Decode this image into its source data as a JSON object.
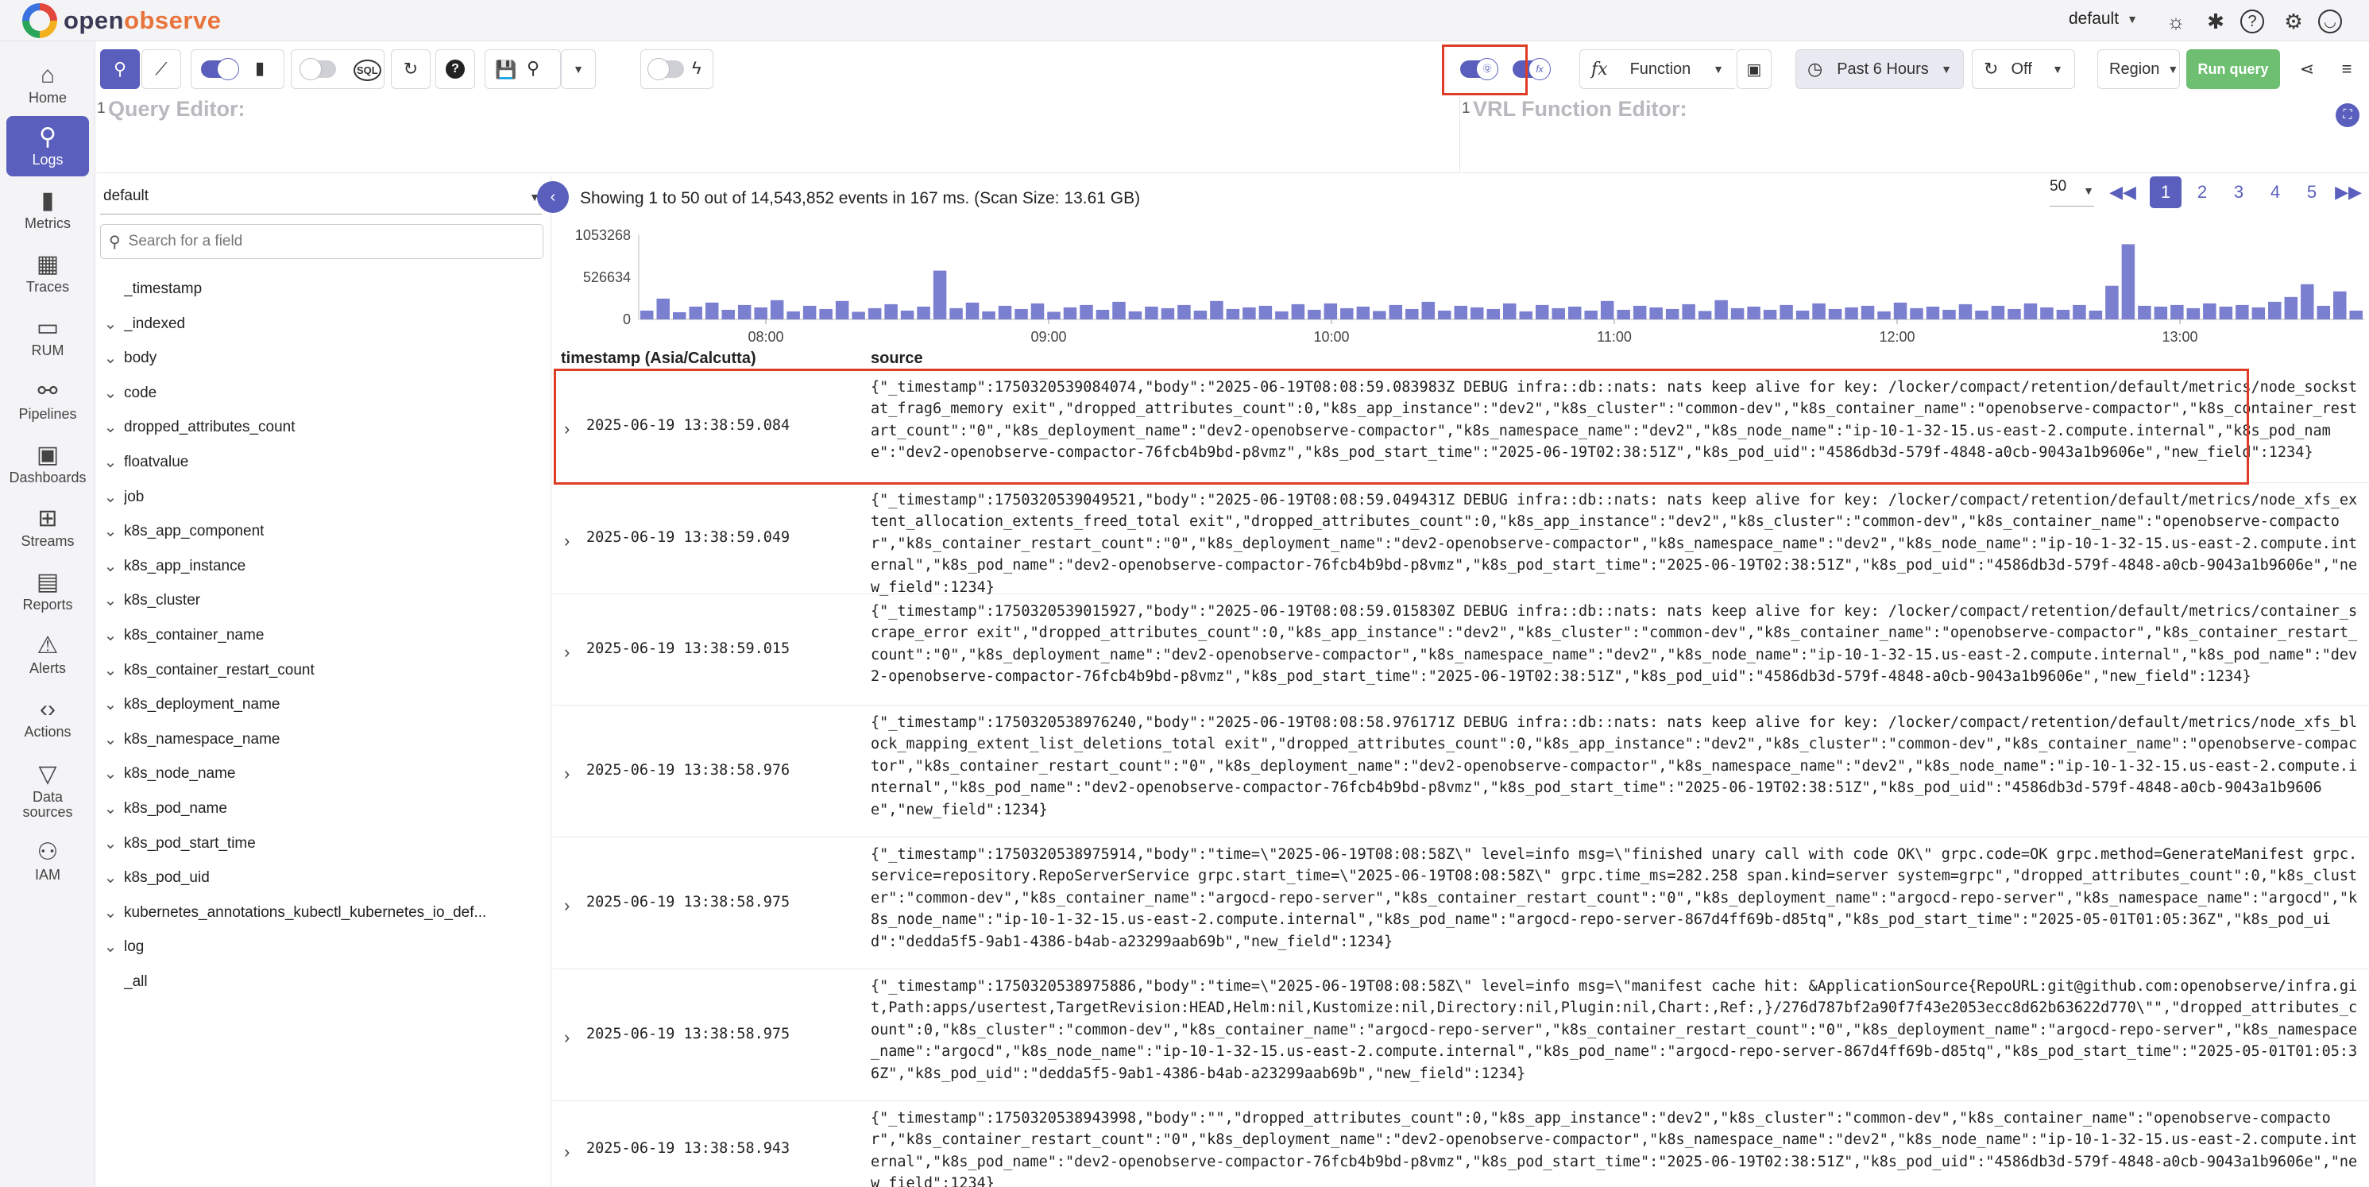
{
  "app": {
    "logo_part1": "open",
    "logo_part2": "observe",
    "org": "default"
  },
  "sidebar": {
    "items": [
      {
        "label": "Home",
        "icon": "home-icon",
        "glyph": "⌂"
      },
      {
        "label": "Logs",
        "icon": "search-icon",
        "glyph": "🔍"
      },
      {
        "label": "Metrics",
        "icon": "bar-chart-icon",
        "glyph": "▮"
      },
      {
        "label": "Traces",
        "icon": "traces-icon",
        "glyph": "▦"
      },
      {
        "label": "RUM",
        "icon": "devices-icon",
        "glyph": "▭"
      },
      {
        "label": "Pipelines",
        "icon": "pipelines-icon",
        "glyph": "⚯"
      },
      {
        "label": "Dashboards",
        "icon": "dashboard-icon",
        "glyph": "▣"
      },
      {
        "label": "Streams",
        "icon": "streams-icon",
        "glyph": "⊞"
      },
      {
        "label": "Reports",
        "icon": "reports-icon",
        "glyph": "▤"
      },
      {
        "label": "Alerts",
        "icon": "alert-icon",
        "glyph": "⚠"
      },
      {
        "label": "Actions",
        "icon": "code-icon",
        "glyph": "‹›"
      },
      {
        "label": "Data sources",
        "icon": "filter-icon",
        "glyph": "▽"
      },
      {
        "label": "IAM",
        "icon": "users-gear-icon",
        "glyph": "⚇"
      }
    ]
  },
  "toolbar": {
    "function_label": "Function",
    "time_range": "Past 6 Hours",
    "refresh": "Off",
    "region": "Region",
    "run_query": "Run query"
  },
  "editors": {
    "query_line": "1",
    "query_placeholder": "Query Editor:",
    "vrl_line": "1",
    "vrl_placeholder": "VRL Function Editor:"
  },
  "fields": {
    "stream": "default",
    "search_placeholder": "Search for a field",
    "items": [
      {
        "name": "_timestamp",
        "chevron": false
      },
      {
        "name": "_indexed",
        "chevron": true
      },
      {
        "name": "body",
        "chevron": true
      },
      {
        "name": "code",
        "chevron": true
      },
      {
        "name": "dropped_attributes_count",
        "chevron": true
      },
      {
        "name": "floatvalue",
        "chevron": true
      },
      {
        "name": "job",
        "chevron": true
      },
      {
        "name": "k8s_app_component",
        "chevron": true
      },
      {
        "name": "k8s_app_instance",
        "chevron": true
      },
      {
        "name": "k8s_cluster",
        "chevron": true
      },
      {
        "name": "k8s_container_name",
        "chevron": true
      },
      {
        "name": "k8s_container_restart_count",
        "chevron": true
      },
      {
        "name": "k8s_deployment_name",
        "chevron": true
      },
      {
        "name": "k8s_namespace_name",
        "chevron": true
      },
      {
        "name": "k8s_node_name",
        "chevron": true
      },
      {
        "name": "k8s_pod_name",
        "chevron": true
      },
      {
        "name": "k8s_pod_start_time",
        "chevron": true
      },
      {
        "name": "k8s_pod_uid",
        "chevron": true
      },
      {
        "name": "kubernetes_annotations_kubectl_kubernetes_io_def...",
        "chevron": true
      },
      {
        "name": "log",
        "chevron": true
      },
      {
        "name": "_all",
        "chevron": false
      }
    ]
  },
  "results": {
    "summary": "Showing 1 to 50 out of 14,543,852 events in 167 ms. (Scan Size: 13.61 GB)",
    "rows_per_page": "50",
    "pages": [
      "1",
      "2",
      "3",
      "4",
      "5"
    ],
    "current_page": 1,
    "col_timestamp": "timestamp (Asia/Calcutta)",
    "col_source": "source"
  },
  "chart_data": {
    "type": "bar",
    "y_ticks": [
      "1053268",
      "526634",
      "0"
    ],
    "x_ticks": [
      "08:00",
      "09:00",
      "10:00",
      "11:00",
      "12:00",
      "13:00"
    ],
    "ylim": [
      0,
      1053268
    ],
    "values": [
      110000,
      260000,
      90000,
      160000,
      210000,
      120000,
      180000,
      150000,
      240000,
      100000,
      170000,
      130000,
      230000,
      95000,
      140000,
      190000,
      110000,
      160000,
      610000,
      140000,
      210000,
      100000,
      170000,
      130000,
      200000,
      95000,
      150000,
      180000,
      120000,
      220000,
      100000,
      160000,
      140000,
      180000,
      110000,
      230000,
      130000,
      150000,
      170000,
      100000,
      190000,
      120000,
      200000,
      140000,
      160000,
      105000,
      180000,
      130000,
      220000,
      110000,
      170000,
      150000,
      130000,
      200000,
      100000,
      180000,
      140000,
      160000,
      110000,
      230000,
      120000,
      170000,
      150000,
      130000,
      190000,
      105000,
      240000,
      140000,
      160000,
      120000,
      180000,
      110000,
      200000,
      130000,
      150000,
      170000,
      100000,
      210000,
      140000,
      160000,
      120000,
      190000,
      110000,
      170000,
      130000,
      200000,
      150000,
      120000,
      180000,
      110000,
      420000,
      940000,
      170000,
      160000,
      180000,
      140000,
      200000,
      160000,
      180000,
      150000,
      220000,
      280000,
      440000,
      170000,
      350000,
      110000
    ]
  },
  "logs": [
    {
      "timestamp": "2025-06-19 13:38:59.084",
      "source": "{\"_timestamp\":1750320539084074,\"body\":\"2025-06-19T08:08:59.083983Z DEBUG infra::db::nats: nats keep alive for key: /locker/compact/retention/default/metrics/node_sockstat_frag6_memory exit\",\"dropped_attributes_count\":0,\"k8s_app_instance\":\"dev2\",\"k8s_cluster\":\"common-dev\",\"k8s_container_name\":\"openobserve-compactor\",\"k8s_container_restart_count\":\"0\",\"k8s_deployment_name\":\"dev2-openobserve-compactor\",\"k8s_namespace_name\":\"dev2\",\"k8s_node_name\":\"ip-10-1-32-15.us-east-2.compute.internal\",\"k8s_pod_name\":\"dev2-openobserve-compactor-76fcb4b9bd-p8vmz\",\"k8s_pod_start_time\":\"2025-06-19T02:38:51Z\",\"k8s_pod_uid\":\"4586db3d-579f-4848-a0cb-9043a1b9606e\",\"new_field\":1234}"
    },
    {
      "timestamp": "2025-06-19 13:38:59.049",
      "source": "{\"_timestamp\":1750320539049521,\"body\":\"2025-06-19T08:08:59.049431Z DEBUG infra::db::nats: nats keep alive for key: /locker/compact/retention/default/metrics/node_xfs_extent_allocation_extents_freed_total exit\",\"dropped_attributes_count\":0,\"k8s_app_instance\":\"dev2\",\"k8s_cluster\":\"common-dev\",\"k8s_container_name\":\"openobserve-compactor\",\"k8s_container_restart_count\":\"0\",\"k8s_deployment_name\":\"dev2-openobserve-compactor\",\"k8s_namespace_name\":\"dev2\",\"k8s_node_name\":\"ip-10-1-32-15.us-east-2.compute.internal\",\"k8s_pod_name\":\"dev2-openobserve-compactor-76fcb4b9bd-p8vmz\",\"k8s_pod_start_time\":\"2025-06-19T02:38:51Z\",\"k8s_pod_uid\":\"4586db3d-579f-4848-a0cb-9043a1b9606e\",\"new_field\":1234}"
    },
    {
      "timestamp": "2025-06-19 13:38:59.015",
      "source": "{\"_timestamp\":1750320539015927,\"body\":\"2025-06-19T08:08:59.015830Z DEBUG infra::db::nats: nats keep alive for key: /locker/compact/retention/default/metrics/container_scrape_error exit\",\"dropped_attributes_count\":0,\"k8s_app_instance\":\"dev2\",\"k8s_cluster\":\"common-dev\",\"k8s_container_name\":\"openobserve-compactor\",\"k8s_container_restart_count\":\"0\",\"k8s_deployment_name\":\"dev2-openobserve-compactor\",\"k8s_namespace_name\":\"dev2\",\"k8s_node_name\":\"ip-10-1-32-15.us-east-2.compute.internal\",\"k8s_pod_name\":\"dev2-openobserve-compactor-76fcb4b9bd-p8vmz\",\"k8s_pod_start_time\":\"2025-06-19T02:38:51Z\",\"k8s_pod_uid\":\"4586db3d-579f-4848-a0cb-9043a1b9606e\",\"new_field\":1234}"
    },
    {
      "timestamp": "2025-06-19 13:38:58.976",
      "source": "{\"_timestamp\":1750320538976240,\"body\":\"2025-06-19T08:08:58.976171Z DEBUG infra::db::nats: nats keep alive for key: /locker/compact/retention/default/metrics/node_xfs_block_mapping_extent_list_deletions_total exit\",\"dropped_attributes_count\":0,\"k8s_app_instance\":\"dev2\",\"k8s_cluster\":\"common-dev\",\"k8s_container_name\":\"openobserve-compactor\",\"k8s_container_restart_count\":\"0\",\"k8s_deployment_name\":\"dev2-openobserve-compactor\",\"k8s_namespace_name\":\"dev2\",\"k8s_node_name\":\"ip-10-1-32-15.us-east-2.compute.internal\",\"k8s_pod_name\":\"dev2-openobserve-compactor-76fcb4b9bd-p8vmz\",\"k8s_pod_start_time\":\"2025-06-19T02:38:51Z\",\"k8s_pod_uid\":\"4586db3d-579f-4848-a0cb-9043a1b9606e\",\"new_field\":1234}"
    },
    {
      "timestamp": "2025-06-19 13:38:58.975",
      "source": "{\"_timestamp\":1750320538975914,\"body\":\"time=\\\"2025-06-19T08:08:58Z\\\" level=info msg=\\\"finished unary call with code OK\\\" grpc.code=OK grpc.method=GenerateManifest grpc.service=repository.RepoServerService grpc.start_time=\\\"2025-06-19T08:08:58Z\\\" grpc.time_ms=282.258 span.kind=server system=grpc\",\"dropped_attributes_count\":0,\"k8s_cluster\":\"common-dev\",\"k8s_container_name\":\"argocd-repo-server\",\"k8s_container_restart_count\":\"0\",\"k8s_deployment_name\":\"argocd-repo-server\",\"k8s_namespace_name\":\"argocd\",\"k8s_node_name\":\"ip-10-1-32-15.us-east-2.compute.internal\",\"k8s_pod_name\":\"argocd-repo-server-867d4ff69b-d85tq\",\"k8s_pod_start_time\":\"2025-05-01T01:05:36Z\",\"k8s_pod_uid\":\"dedda5f5-9ab1-4386-b4ab-a23299aab69b\",\"new_field\":1234}"
    },
    {
      "timestamp": "2025-06-19 13:38:58.975",
      "source": "{\"_timestamp\":1750320538975886,\"body\":\"time=\\\"2025-06-19T08:08:58Z\\\" level=info msg=\\\"manifest cache hit: &ApplicationSource{RepoURL:git@github.com:openobserve/infra.git,Path:apps/usertest,TargetRevision:HEAD,Helm:nil,Kustomize:nil,Directory:nil,Plugin:nil,Chart:,Ref:,}/276d787bf2a90f7f43e2053ecc8d62b63622d770\\\"\",\"dropped_attributes_count\":0,\"k8s_cluster\":\"common-dev\",\"k8s_container_name\":\"argocd-repo-server\",\"k8s_container_restart_count\":\"0\",\"k8s_deployment_name\":\"argocd-repo-server\",\"k8s_namespace_name\":\"argocd\",\"k8s_node_name\":\"ip-10-1-32-15.us-east-2.compute.internal\",\"k8s_pod_name\":\"argocd-repo-server-867d4ff69b-d85tq\",\"k8s_pod_start_time\":\"2025-05-01T01:05:36Z\",\"k8s_pod_uid\":\"dedda5f5-9ab1-4386-b4ab-a23299aab69b\",\"new_field\":1234}"
    },
    {
      "timestamp": "2025-06-19 13:38:58.943",
      "source": "{\"_timestamp\":1750320538943998,\"body\":\"\",\"dropped_attributes_count\":0,\"k8s_app_instance\":\"dev2\",\"k8s_cluster\":\"common-dev\",\"k8s_container_name\":\"openobserve-compactor\",\"k8s_container_restart_count\":\"0\",\"k8s_deployment_name\":\"dev2-openobserve-compactor\",\"k8s_namespace_name\":\"dev2\",\"k8s_node_name\":\"ip-10-1-32-15.us-east-2.compute.internal\",\"k8s_pod_name\":\"dev2-openobserve-compactor-76fcb4b9bd-p8vmz\",\"k8s_pod_start_time\":\"2025-06-19T02:38:51Z\",\"k8s_pod_uid\":\"4586db3d-579f-4848-a0cb-9043a1b9606e\",\"new_field\":1234}"
    }
  ],
  "colors": {
    "accent": "#5a5fbd",
    "bar": "#7b7fd0",
    "run_button": "#6fbf73",
    "highlight": "#e03b25"
  }
}
